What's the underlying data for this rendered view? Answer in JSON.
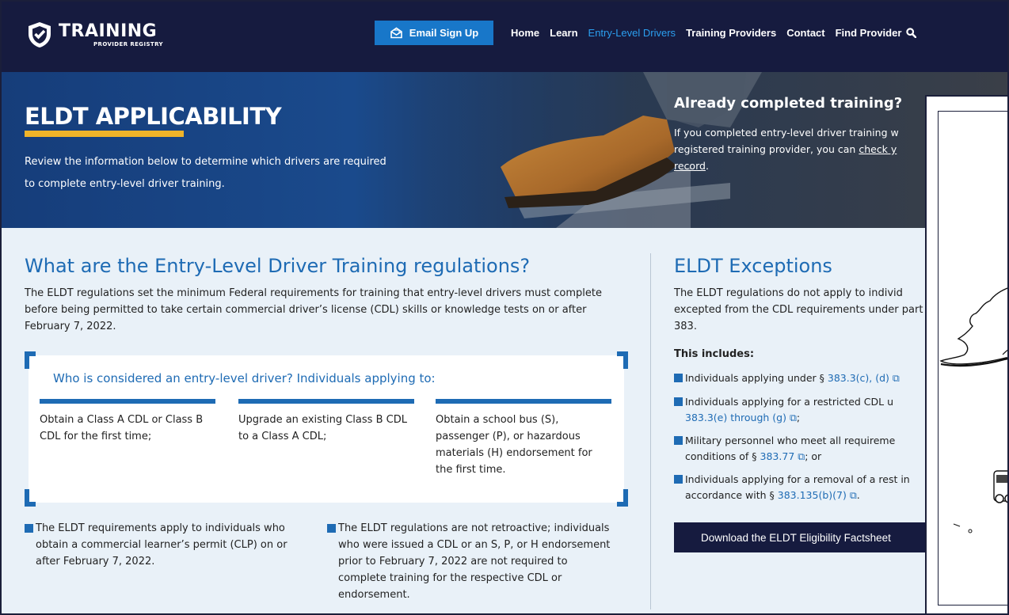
{
  "header": {
    "logo": {
      "main": "TRAINING",
      "sub": "PROVIDER REGISTRY"
    },
    "email_signup": "Email Sign Up",
    "nav": [
      {
        "label": "Home",
        "active": false
      },
      {
        "label": "Learn",
        "active": false
      },
      {
        "label": "Entry-Level Drivers",
        "active": true
      },
      {
        "label": "Training Providers",
        "active": false
      },
      {
        "label": "Contact",
        "active": false
      },
      {
        "label": "Find Provider",
        "active": false
      }
    ]
  },
  "hero": {
    "title": "ELDT APPLICABILITY",
    "description": "Review the information below to determine which drivers are required to complete entry-level driver training.",
    "completed": {
      "title": "Already completed training?",
      "text_before": "If you completed entry-level driver training w",
      "text_line2": "registered training provider, you can ",
      "link_text": "check y",
      "link_text2": "record",
      "text_after": "."
    }
  },
  "regulations": {
    "title": "What are the Entry-Level Driver Training regulations?",
    "body": "The ELDT regulations set the minimum Federal requirements for training that entry-level drivers must complete before being permitted to take certain commercial driver’s license (CDL) skills or knowledge tests on or after February 7, 2022.",
    "who": {
      "title": "Who is considered an entry-level driver? Individuals applying to:",
      "columns": [
        "Obtain a Class A CDL or Class B CDL for the first time;",
        "Upgrade an existing Class B CDL to a Class A CDL;",
        "Obtain a school bus (S), passenger (P), or hazardous materials (H) endorsement for the first time."
      ]
    },
    "bullets": [
      "The ELDT requirements apply to individuals who obtain a commercial learner’s permit (CLP) on or after February 7, 2022.",
      "The ELDT regulations are not retroactive; individuals who were issued a CDL or an S, P, or H endorsement prior to February 7, 2022 are not required to complete training for the respective CDL or endorsement."
    ]
  },
  "exceptions": {
    "title": "ELDT Exceptions",
    "body": "The ELDT regulations do not apply to individ excepted from the CDL requirements under part 383.",
    "includes_label": "This includes:",
    "items": [
      {
        "text": "Individuals applying under § ",
        "link": "383.3(c), (d)",
        "after": ""
      },
      {
        "text": "Individuals applying for a restricted CDL u",
        "link": "383.3(e) through (g)",
        "after": ";"
      },
      {
        "text": "Military personnel who meet all requireme conditions of § ",
        "link": "383.77",
        "after": "; or"
      },
      {
        "text": "Individuals applying for a removal of a rest in accordance with § ",
        "link": "383.135(b)(7)",
        "after": "."
      }
    ],
    "download_label": "Download the ELDT Eligibility Factsheet"
  },
  "colors": {
    "navy": "#161b3f",
    "brand_blue": "#1e6bb4",
    "link_blue": "#2b9ff0",
    "accent_gold": "#f0b429",
    "light_bg": "#e9f1f8"
  },
  "icons": {
    "logo": "shield-check-icon",
    "email": "envelope-icon",
    "search": "search-icon",
    "external": "external-link-icon"
  }
}
